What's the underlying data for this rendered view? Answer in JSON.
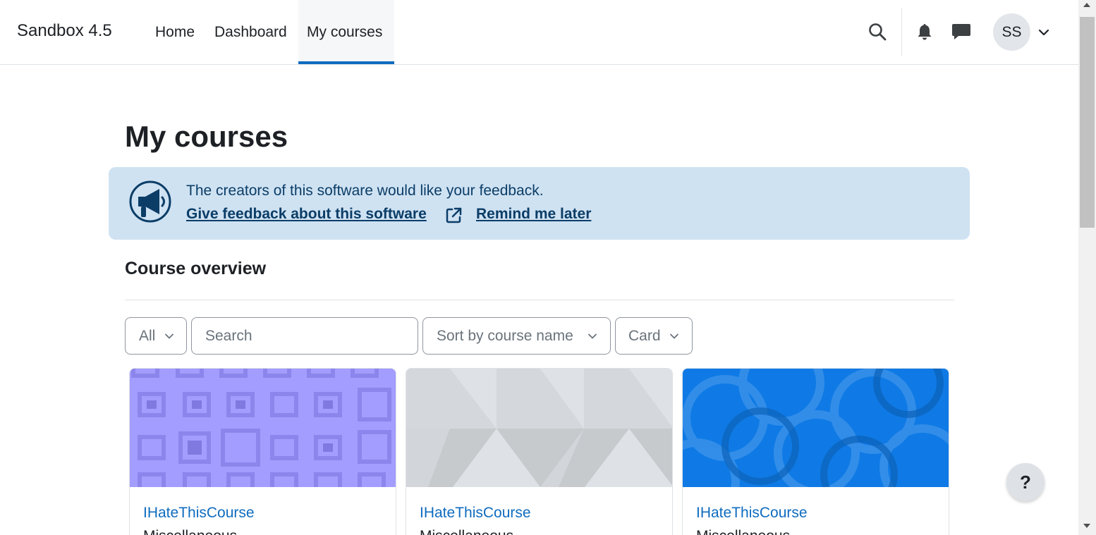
{
  "brand": "Sandbox 4.5",
  "nav": {
    "home": "Home",
    "dashboard": "Dashboard",
    "my_courses": "My courses"
  },
  "user": {
    "initials": "SS"
  },
  "page": {
    "title": "My courses"
  },
  "alert": {
    "text": "The creators of this software would like your feedback.",
    "link_feedback": "Give feedback about this software",
    "link_later": "Remind me later"
  },
  "overview": {
    "title": "Course overview",
    "filter": "All",
    "search_placeholder": "Search",
    "sort": "Sort by course name",
    "view": "Card"
  },
  "courses": [
    {
      "title": "IHateThisCourse",
      "category": "Miscellaneous",
      "image_color": "#a39dff"
    },
    {
      "title": "IHateThisCourse",
      "category": "Miscellaneous",
      "image_color": "#dee2e6"
    },
    {
      "title": "IHateThisCourse",
      "category": "Miscellaneous",
      "image_color": "#0f7ae5"
    }
  ],
  "help": {
    "label": "?"
  },
  "colors": {
    "primary": "#0f6cbf",
    "alert_bg": "#cfe2f2",
    "alert_text": "#0b3d67"
  }
}
